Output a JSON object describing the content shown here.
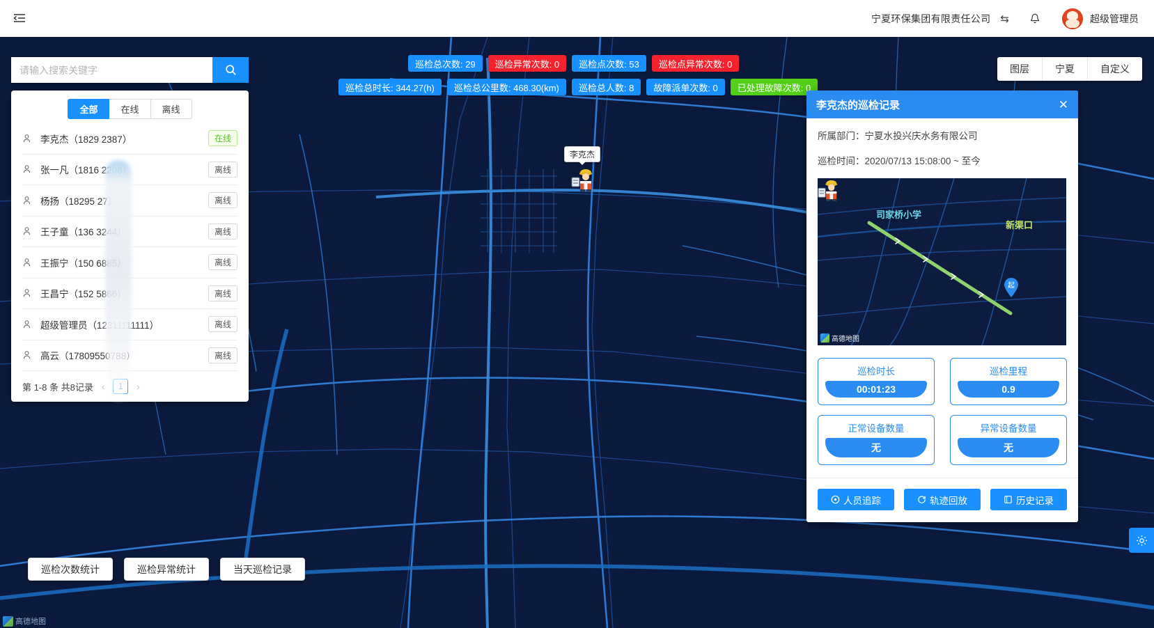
{
  "header": {
    "collapse_icon": "menu-fold-icon",
    "company": "宁夏环保集团有限责任公司",
    "switch_icon": "⇆",
    "bell_icon": "bell-icon",
    "user_name": "超级管理员"
  },
  "search": {
    "placeholder": "请输入搜索关键字",
    "value": "",
    "button_icon": "search-icon"
  },
  "person_panel": {
    "tabs": [
      {
        "label": "全部",
        "active": true
      },
      {
        "label": "在线",
        "active": false
      },
      {
        "label": "离线",
        "active": false
      }
    ],
    "people": [
      {
        "name": "李克杰（1829     2387）",
        "status": "在线",
        "online": true
      },
      {
        "name": "张一凡（1816     2206）",
        "status": "离线",
        "online": false
      },
      {
        "name": "杨扬（18295       27）",
        "status": "离线",
        "online": false
      },
      {
        "name": "王子童（136      3244）",
        "status": "离线",
        "online": false
      },
      {
        "name": "王振宁（150      6885）",
        "status": "离线",
        "online": false
      },
      {
        "name": "王昌宁（152      5866）",
        "status": "离线",
        "online": false
      },
      {
        "name": "超级管理员（12311111111）",
        "status": "离线",
        "online": false
      },
      {
        "name": "高云（17809550788）",
        "status": "离线",
        "online": false
      }
    ],
    "pager": {
      "summary": "第 1-8 条 共8记录",
      "prev": "‹",
      "page": "1",
      "next": "›"
    }
  },
  "stats": {
    "row1": [
      {
        "label": "巡检总次数: 29",
        "color": "#1890ff"
      },
      {
        "label": "巡检异常次数: 0",
        "color": "#f5222d"
      },
      {
        "label": "巡检点次数: 53",
        "color": "#1890ff"
      },
      {
        "label": "巡检点异常次数: 0",
        "color": "#f5222d"
      }
    ],
    "row2": [
      {
        "label": "巡检总时长: 344.27(h)",
        "color": "#1890ff"
      },
      {
        "label": "巡检总公里数: 468.30(km)",
        "color": "#1890ff"
      },
      {
        "label": "巡检总人数: 8",
        "color": "#1890ff"
      },
      {
        "label": "故障派单次数: 0",
        "color": "#1890ff"
      },
      {
        "label": "已处理故障次数: 0",
        "color": "#52d017"
      }
    ]
  },
  "layer_control": {
    "items": [
      "图层",
      "宁夏",
      "自定义"
    ]
  },
  "map": {
    "marker_label": "李克杰",
    "marker_icon": "worker-avatar-icon",
    "attribution": "高德地图"
  },
  "detail": {
    "title": "李克杰的巡检记录",
    "close_icon": "✕",
    "department_line": "所属部门：宁夏水投兴庆水务有限公司",
    "time_line": "巡检时间：2020/07/13 15:08:00 ~ 至今",
    "mini_map": {
      "poi_label": "司家桥小学",
      "channel_label": "新渠口",
      "start_label": "起",
      "attribution": "高德地图",
      "track_color": "#8ed36b"
    },
    "stats": [
      {
        "label": "巡检时长",
        "value": "00:01:23"
      },
      {
        "label": "巡检里程",
        "value": "0.9"
      },
      {
        "label": "正常设备数量",
        "value": "无"
      },
      {
        "label": "异常设备数量",
        "value": "无"
      }
    ],
    "actions": [
      {
        "label": "人员追踪",
        "icon": "location-pin-icon"
      },
      {
        "label": "轨迹回放",
        "icon": "refresh-icon"
      },
      {
        "label": "历史记录",
        "icon": "book-icon"
      }
    ]
  },
  "bottom_buttons": [
    "巡检次数统计",
    "巡检异常统计",
    "当天巡检记录"
  ],
  "gear_fab": {
    "icon": "gear-icon"
  },
  "colors": {
    "accent": "#1890ff",
    "danger": "#f5222d",
    "success": "#52d017",
    "map_bg": "#0b1a3c",
    "panel_header": "#2a8cf0"
  }
}
